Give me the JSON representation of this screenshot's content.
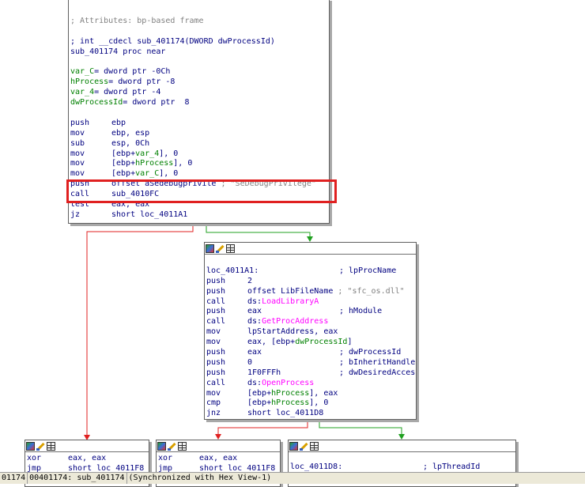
{
  "block_top": {
    "lines": [
      {
        "t": "cmt",
        "text": "; Attributes: bp-based frame"
      },
      {
        "t": "blank"
      },
      {
        "t": "plain",
        "text": "; int __cdecl sub_401174(DWORD dwProcessId)"
      },
      {
        "t": "plain",
        "text": "sub_401174 proc near"
      },
      {
        "t": "blank"
      },
      {
        "t": "var",
        "name": "var_C",
        "rest": "= dword ptr -0Ch"
      },
      {
        "t": "var",
        "name": "hProcess",
        "rest": "= dword ptr -8"
      },
      {
        "t": "var",
        "name": "var_4",
        "rest": "= dword ptr -4"
      },
      {
        "t": "var",
        "name": "dwProcessId",
        "rest": "= dword ptr  8"
      },
      {
        "t": "blank"
      },
      {
        "t": "ins",
        "mn": "push",
        "op": "ebp"
      },
      {
        "t": "ins",
        "mn": "mov",
        "op": "ebp, esp"
      },
      {
        "t": "ins",
        "mn": "sub",
        "op": "esp, 0Ch"
      },
      {
        "t": "ins",
        "mn": "mov",
        "op": "[ebp+var_4], 0"
      },
      {
        "t": "ins",
        "mn": "mov",
        "op": "[ebp+hProcess], 0"
      },
      {
        "t": "ins",
        "mn": "mov",
        "op": "[ebp+var_C], 0"
      },
      {
        "t": "ins",
        "mn": "push",
        "op": "offset aSedebugprivile ; \"SeDebugPrivilege\""
      },
      {
        "t": "ins",
        "mn": "call",
        "op": "sub_4010FC"
      },
      {
        "t": "ins",
        "mn": "test",
        "op": "eax, eax"
      },
      {
        "t": "ins",
        "mn": "jz",
        "op": "short loc_4011A1"
      }
    ]
  },
  "block_mid": {
    "lines": [
      {
        "t": "blank"
      },
      {
        "t": "lbl",
        "text": "loc_4011A1:",
        "cmt": "; lpProcName"
      },
      {
        "t": "ins",
        "mn": "push",
        "op": "2"
      },
      {
        "t": "ins",
        "mn": "push",
        "op": "offset LibFileName ; \"sfc_os.dll\""
      },
      {
        "t": "ins",
        "mn": "call",
        "op": "ds:LoadLibraryA"
      },
      {
        "t": "ins",
        "mn": "push",
        "op": "eax",
        "cmt": "; hModule"
      },
      {
        "t": "ins",
        "mn": "call",
        "op": "ds:GetProcAddress"
      },
      {
        "t": "ins",
        "mn": "mov",
        "op": "lpStartAddress, eax"
      },
      {
        "t": "ins",
        "mn": "mov",
        "op": "eax, [ebp+dwProcessId]"
      },
      {
        "t": "ins",
        "mn": "push",
        "op": "eax",
        "cmt": "; dwProcessId"
      },
      {
        "t": "ins",
        "mn": "push",
        "op": "0",
        "cmt": "; bInheritHandle"
      },
      {
        "t": "ins",
        "mn": "push",
        "op": "1F0FFFh",
        "cmt": "; dwDesiredAccess"
      },
      {
        "t": "ins",
        "mn": "call",
        "op": "ds:OpenProcess"
      },
      {
        "t": "ins",
        "mn": "mov",
        "op": "[ebp+hProcess], eax"
      },
      {
        "t": "ins",
        "mn": "cmp",
        "op": "[ebp+hProcess], 0"
      },
      {
        "t": "ins",
        "mn": "jnz",
        "op": "short loc_4011D8"
      }
    ]
  },
  "block_bl": {
    "lines": [
      {
        "t": "ins",
        "mn": "xor",
        "op": "eax, eax"
      },
      {
        "t": "ins",
        "mn": "jmp",
        "op": "short loc_4011F8"
      }
    ]
  },
  "block_bm": {
    "lines": [
      {
        "t": "ins",
        "mn": "xor",
        "op": "eax, eax"
      },
      {
        "t": "ins",
        "mn": "jmp",
        "op": "short loc_4011F8"
      }
    ]
  },
  "block_br": {
    "lines": [
      {
        "t": "blank"
      },
      {
        "t": "lbl",
        "text": "loc_4011D8:",
        "cmt": "; lpThreadId"
      }
    ]
  },
  "status": {
    "offset": "01174",
    "address": "00401174: sub_401174",
    "sync": "(Synchronized with Hex View-1)"
  },
  "colors": {
    "false_edge": "#e02020",
    "true_edge": "#20a020",
    "highlight": "#e02020"
  }
}
